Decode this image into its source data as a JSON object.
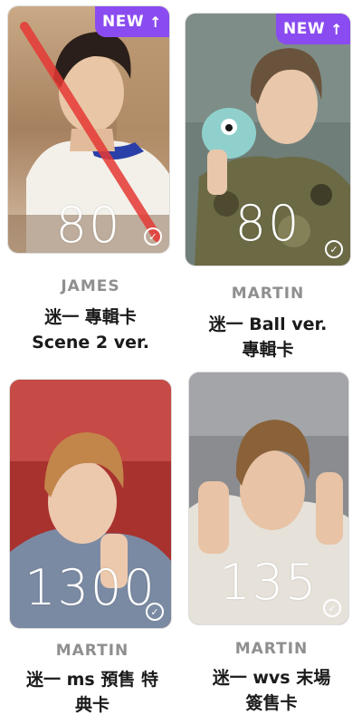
{
  "cards": [
    {
      "member": "JAMES",
      "title_line1": "迷一 專輯卡",
      "title_line2": "Scene 2 ver.",
      "price": "80",
      "badge": "NEW",
      "badge_arrow": "↑",
      "check": "✓",
      "crossed_out": true
    },
    {
      "member": "MARTIN",
      "title_line1": "迷一 Ball ver.",
      "title_line2": "專輯卡",
      "price": "80",
      "badge": "NEW",
      "badge_arrow": "↑",
      "check": "✓"
    },
    {
      "member": "MARTIN",
      "title_line1": "迷一 ms 預售 特",
      "title_line2": "典卡",
      "price": "1300",
      "check": "✓"
    },
    {
      "member": "MARTIN",
      "title_line1": "迷一 wvs 末場",
      "title_line2": "簽售卡",
      "price": "135",
      "check": "✓"
    }
  ],
  "colors": {
    "badge": "#8a4cf0",
    "strike": "#e53935",
    "member_text": "#8f8f8f"
  },
  "icons": [
    "arrow-up-icon",
    "checkmark-circle-icon"
  ]
}
